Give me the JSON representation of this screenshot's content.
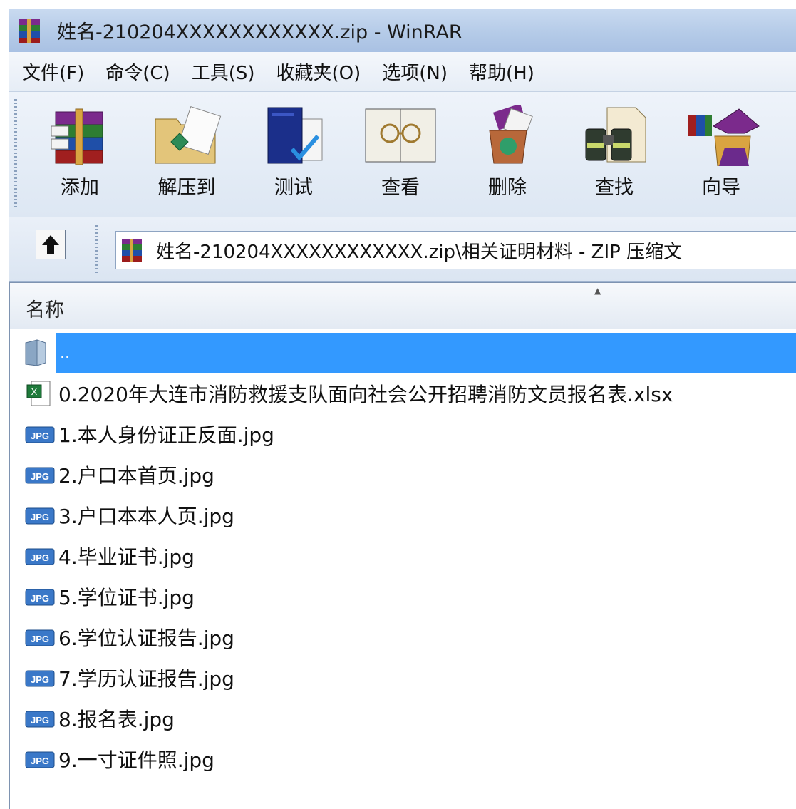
{
  "window": {
    "title": "姓名-210204XXXXXXXXXXXX.zip - WinRAR"
  },
  "menu": [
    {
      "label": "文件(F)"
    },
    {
      "label": "命令(C)"
    },
    {
      "label": "工具(S)"
    },
    {
      "label": "收藏夹(O)"
    },
    {
      "label": "选项(N)"
    },
    {
      "label": "帮助(H)"
    }
  ],
  "toolbar": {
    "add_label": "添加",
    "extract_label": "解压到",
    "test_label": "测试",
    "view_label": "查看",
    "delete_label": "删除",
    "find_label": "查找",
    "wizard_label": "向导"
  },
  "address": {
    "path": "姓名-210204XXXXXXXXXXXX.zip\\相关证明材料 - ZIP 压缩文"
  },
  "columns": {
    "name": "名称"
  },
  "files": {
    "parent": "..",
    "items": [
      {
        "name": "0.2020年大连市消防救援支队面向社会公开招聘消防文员报名表.xlsx",
        "icon": "excel-file-icon"
      },
      {
        "name": "1.本人身份证正反面.jpg",
        "icon": "jpg-file-icon"
      },
      {
        "name": "2.户口本首页.jpg",
        "icon": "jpg-file-icon"
      },
      {
        "name": "3.户口本本人页.jpg",
        "icon": "jpg-file-icon"
      },
      {
        "name": "4.毕业证书.jpg",
        "icon": "jpg-file-icon"
      },
      {
        "name": "5.学位证书.jpg",
        "icon": "jpg-file-icon"
      },
      {
        "name": "6.学位认证报告.jpg",
        "icon": "jpg-file-icon"
      },
      {
        "name": "7.学历认证报告.jpg",
        "icon": "jpg-file-icon"
      },
      {
        "name": "8.报名表.jpg",
        "icon": "jpg-file-icon"
      },
      {
        "name": "9.一寸证件照.jpg",
        "icon": "jpg-file-icon"
      }
    ]
  },
  "colors": {
    "selection": "#3399ff",
    "titlebar": "#b5cbe8"
  }
}
